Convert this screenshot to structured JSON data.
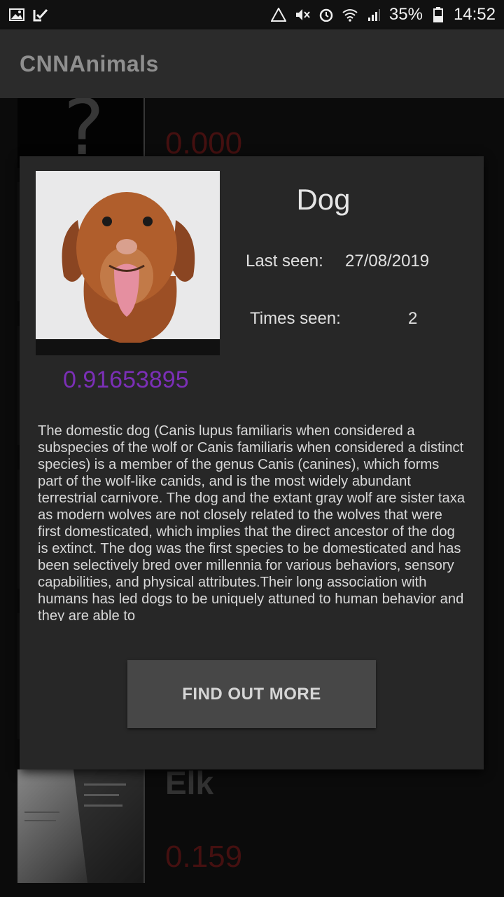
{
  "status_bar": {
    "battery": "35%",
    "time": "14:52"
  },
  "app": {
    "title": "CNNAnimals"
  },
  "background_list": [
    {
      "score": "0.000"
    },
    {
      "name": "Elk",
      "score": "0.159"
    }
  ],
  "dialog": {
    "animal": "Dog",
    "probability": "0.91653895",
    "last_seen_label": "Last seen:",
    "last_seen_value": "27/08/2019",
    "times_seen_label": "Times seen:",
    "times_seen_value": "2",
    "description": "The domestic dog (Canis lupus familiaris when considered a subspecies of the wolf or Canis familiaris when considered a distinct species) is a member of the genus Canis (canines), which forms part of the wolf-like canids, and is the most widely abundant terrestrial carnivore. The dog and the extant gray wolf are sister taxa as modern wolves are not closely related to the wolves that were first domesticated, which implies that the direct ancestor of the dog is extinct. The dog was the first species to be domesticated and has been selectively bred over millennia for various behaviors, sensory capabilities, and physical attributes.Their long association with humans has led dogs to be uniquely attuned to human behavior and they are able to",
    "button_label": "FIND OUT MORE"
  },
  "colors": {
    "probability": "#7b2fb6",
    "score_red": "#6a1a1a",
    "dialog_bg": "#272727",
    "button_bg": "#474747"
  }
}
